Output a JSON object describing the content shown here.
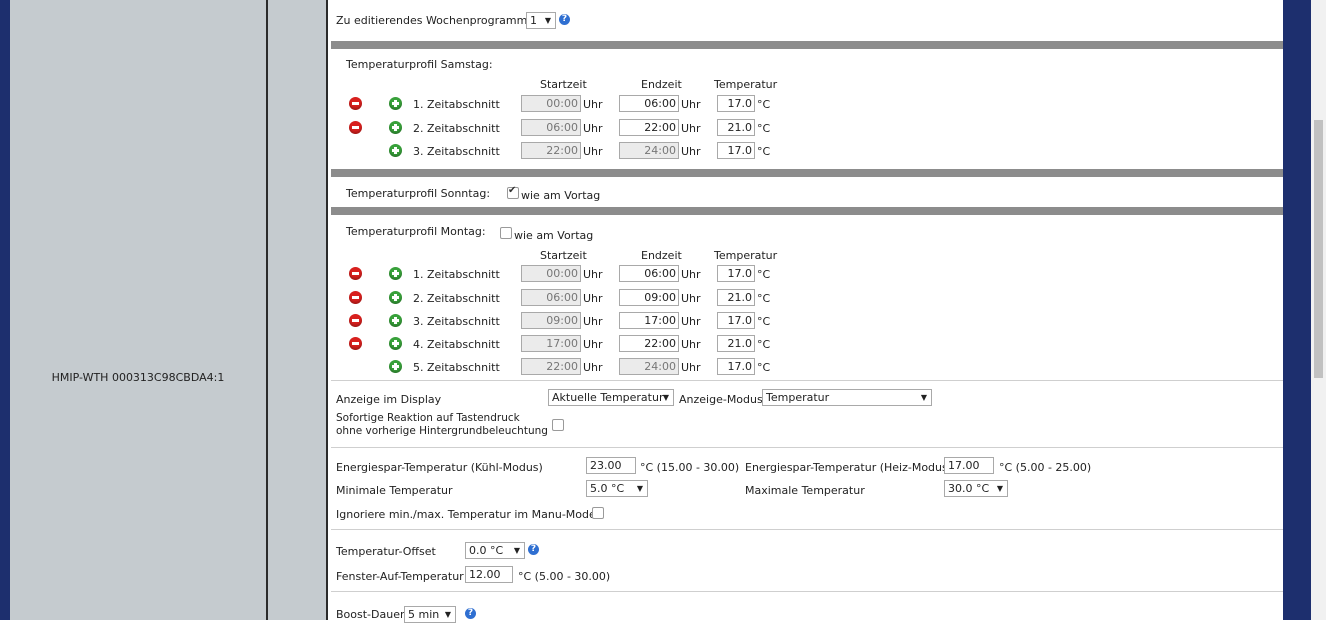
{
  "device": {
    "name": "HMIP-WTH 000313C98CBDA4:1"
  },
  "program": {
    "label": "Zu editierendes Wochenprogramm:",
    "value": "1"
  },
  "headers": {
    "start": "Startzeit",
    "end": "Endzeit",
    "temp": "Temperatur"
  },
  "units": {
    "time": "Uhr",
    "temp": "°C"
  },
  "saturday": {
    "title": "Temperaturprofil Samstag:",
    "rows": [
      {
        "label": "1. Zeitabschnitt",
        "start": "00:00",
        "end": "06:00",
        "temp": "17.0"
      },
      {
        "label": "2. Zeitabschnitt",
        "start": "06:00",
        "end": "22:00",
        "temp": "21.0"
      },
      {
        "label": "3. Zeitabschnitt",
        "start": "22:00",
        "end": "24:00",
        "temp": "17.0"
      }
    ]
  },
  "sunday": {
    "title": "Temperaturprofil Sonntag:",
    "same_as_prev": "wie am Vortag",
    "checked": true
  },
  "monday": {
    "title": "Temperaturprofil Montag:",
    "same_as_prev": "wie am Vortag",
    "checked": false,
    "rows": [
      {
        "label": "1. Zeitabschnitt",
        "start": "00:00",
        "end": "06:00",
        "temp": "17.0"
      },
      {
        "label": "2. Zeitabschnitt",
        "start": "06:00",
        "end": "09:00",
        "temp": "21.0"
      },
      {
        "label": "3. Zeitabschnitt",
        "start": "09:00",
        "end": "17:00",
        "temp": "17.0"
      },
      {
        "label": "4. Zeitabschnitt",
        "start": "17:00",
        "end": "22:00",
        "temp": "21.0"
      },
      {
        "label": "5. Zeitabschnitt",
        "start": "22:00",
        "end": "24:00",
        "temp": "17.0"
      }
    ]
  },
  "display": {
    "label": "Anzeige im Display",
    "value": "Aktuelle Temperatur",
    "mode_label": "Anzeige-Modus",
    "mode_value": "Temperatur",
    "instant_label_1": "Sofortige Reaktion auf Tastendruck",
    "instant_label_2": "ohne vorherige Hintergrundbeleuchtung"
  },
  "energy": {
    "cool_label": "Energiespar-Temperatur (Kühl-Modus)",
    "cool_value": "23.00",
    "cool_range": "°C (15.00 - 30.00)",
    "heat_label": "Energiespar-Temperatur (Heiz-Modus)",
    "heat_value": "17.00",
    "heat_range": "°C (5.00 - 25.00)",
    "min_label": "Minimale Temperatur",
    "min_value": "5.0 °C",
    "max_label": "Maximale Temperatur",
    "max_value": "30.0 °C",
    "ignore_label": "Ignoriere min./max. Temperatur im Manu-Mode"
  },
  "offset": {
    "label": "Temperatur-Offset",
    "value": "0.0 °C",
    "window_label": "Fenster-Auf-Temperatur",
    "window_value": "12.00",
    "window_range": "°C (5.00 - 30.00)"
  },
  "boost": {
    "label": "Boost-Dauer",
    "value": "5 min"
  }
}
